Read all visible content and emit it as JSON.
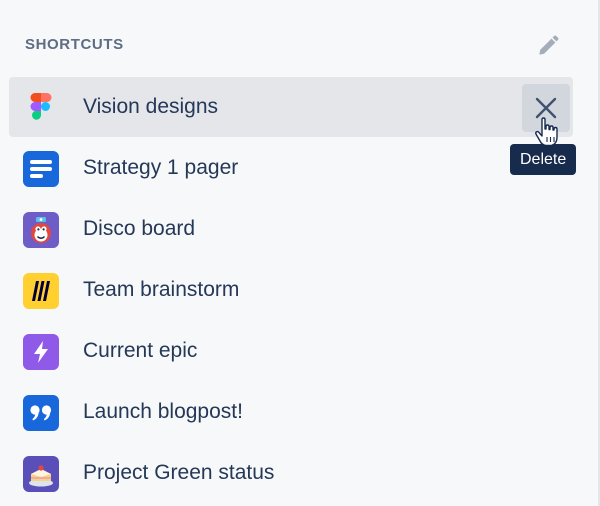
{
  "section": {
    "title": "SHORTCUTS",
    "edit_icon": "pencil-icon"
  },
  "items": [
    {
      "label": "Vision designs",
      "icon": "figma-logo-icon"
    },
    {
      "label": "Strategy 1 pager",
      "icon": "document-lines-icon"
    },
    {
      "label": "Disco board",
      "icon": "disco-board-emoji-icon"
    },
    {
      "label": "Team brainstorm",
      "icon": "miro-logo-icon"
    },
    {
      "label": "Current epic",
      "icon": "lightning-bolt-icon"
    },
    {
      "label": "Launch blogpost!",
      "icon": "quote-marks-icon"
    },
    {
      "label": "Project Green status",
      "icon": "cake-emoji-icon"
    }
  ],
  "delete": {
    "icon": "close-icon",
    "tooltip": "Delete"
  },
  "colors": {
    "background": "#F7F8F9",
    "hover_row": "#E4E6EA",
    "header_text": "#5E6C84",
    "item_text": "#253858",
    "tooltip_bg": "#172B4D",
    "delete_bg": "#D2D6DD",
    "doc_blue": "#1868DB",
    "purple": "#6E5DC6",
    "miro_yellow": "#FFD02F"
  }
}
